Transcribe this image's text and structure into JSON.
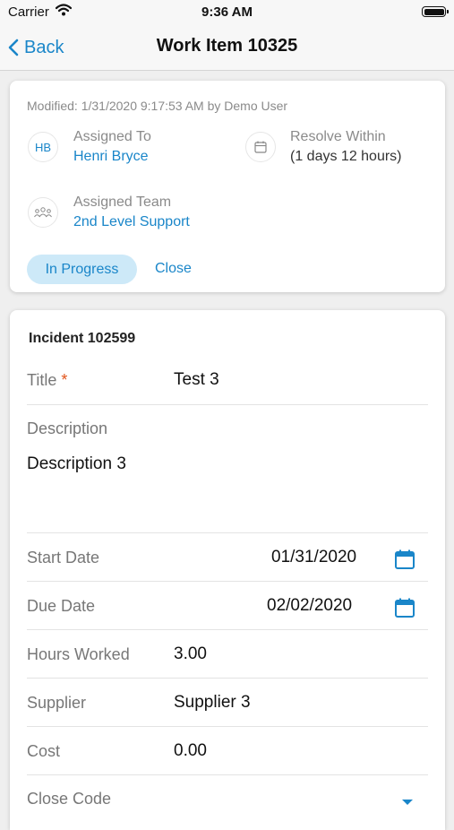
{
  "status_bar": {
    "carrier": "Carrier",
    "time": "9:36 AM"
  },
  "nav": {
    "back_label": "Back",
    "title": "Work Item 10325"
  },
  "summary": {
    "modified": "Modified: 1/31/2020 9:17:53 AM by Demo User",
    "assigned_to_label": "Assigned To",
    "assigned_to_initials": "HB",
    "assigned_to_value": "Henri Bryce",
    "resolve_label": "Resolve Within",
    "resolve_value": "(1 days 12 hours)",
    "team_label": "Assigned Team",
    "team_value": "2nd Level Support",
    "status_label": "In Progress",
    "close_label": "Close"
  },
  "form": {
    "incident": "Incident 102599",
    "title_label": "Title",
    "title_required": "*",
    "title_value": "Test 3",
    "description_label": "Description",
    "description_value": "Description 3",
    "start_date_label": "Start Date",
    "start_date_value": "01/31/2020",
    "due_date_label": "Due Date",
    "due_date_value": "02/02/2020",
    "hours_label": "Hours Worked",
    "hours_value": "3.00",
    "supplier_label": "Supplier",
    "supplier_value": "Supplier 3",
    "cost_label": "Cost",
    "cost_value": "0.00",
    "close_code_label": "Close Code"
  },
  "colors": {
    "accent": "#1a86c9",
    "pill_bg": "#cde9f8",
    "required": "#e2541b"
  }
}
